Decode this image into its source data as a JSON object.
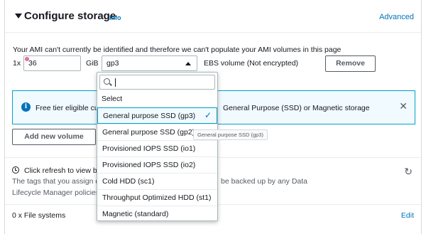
{
  "header": {
    "title": "Configure storage",
    "info_link": "Info",
    "advanced_link": "Advanced"
  },
  "ami_warning": "Your AMI can't currently be identified and therefore we can't populate your AMI volumes in this page",
  "volume_row": {
    "multiplier": "1x",
    "size_value": "36",
    "size_unit": "GiB",
    "volume_type": "gp3",
    "volume_desc": "EBS volume  (Not encrypted)",
    "remove_label": "Remove"
  },
  "free_tier": {
    "text_left": "Free tier eligible cu",
    "text_right": "General Purpose (SSD) or Magnetic storage"
  },
  "add_volume_label": "Add new volume",
  "refresh": {
    "text": "Click refresh to view b",
    "tags_line1_left": "The tags that you assign d",
    "tags_line1_right": "be backed up by any Data",
    "tags_line2": "Lifecycle Manager policies"
  },
  "file_systems": {
    "label": "0 x File systems",
    "edit_label": "Edit"
  },
  "dropdown": {
    "search_placeholder": "",
    "group_label": "Select",
    "options": [
      "General purpose SSD (gp3)",
      "General purpose SSD (gp2)",
      "Provisioned IOPS SSD (io1)",
      "Provisioned IOPS SSD (io2)",
      "Cold HDD (sc1)",
      "Throughput Optimized HDD (st1)",
      "Magnetic (standard)"
    ],
    "selected_index": 0
  },
  "tooltip": "General purpose SSD (gp3)",
  "colors": {
    "link": "#0073bb",
    "accent_border": "#00a1c9",
    "info_bg": "#f1faff"
  }
}
